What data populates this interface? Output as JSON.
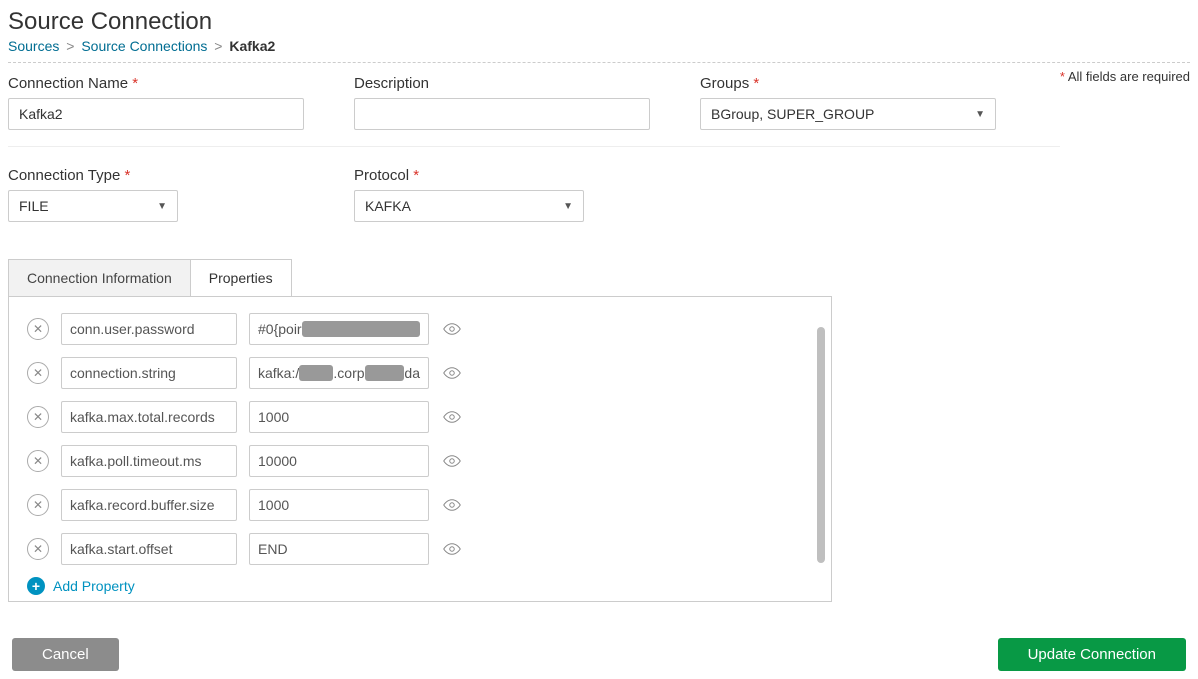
{
  "page_title": "Source Connection",
  "breadcrumb": {
    "items": [
      "Sources",
      "Source Connections"
    ],
    "current": "Kafka2"
  },
  "required_note": "All fields are required",
  "fields": {
    "connection_name": {
      "label": "Connection Name",
      "value": "Kafka2",
      "required": true
    },
    "description": {
      "label": "Description",
      "value": "",
      "required": false
    },
    "groups": {
      "label": "Groups",
      "value": "BGroup,  SUPER_GROUP",
      "required": true
    },
    "connection_type": {
      "label": "Connection Type",
      "value": "FILE",
      "required": true
    },
    "protocol": {
      "label": "Protocol",
      "value": "KAFKA",
      "required": true
    }
  },
  "tabs": {
    "info": "Connection Information",
    "properties": "Properties",
    "active": "properties"
  },
  "properties": [
    {
      "key": "conn.user.password",
      "value_prefix": "#0{poir",
      "redacted": true
    },
    {
      "key": "connection.string",
      "value_prefix": "kafka:/",
      "value_mid": ".corp",
      "value_suffix": "da",
      "redacted_parts": true
    },
    {
      "key": "kafka.max.total.records",
      "value": "1000"
    },
    {
      "key": "kafka.poll.timeout.ms",
      "value": "10000"
    },
    {
      "key": "kafka.record.buffer.size",
      "value": "1000"
    },
    {
      "key": "kafka.start.offset",
      "value": "END"
    }
  ],
  "add_property_label": "Add Property",
  "buttons": {
    "cancel": "Cancel",
    "update": "Update Connection"
  }
}
